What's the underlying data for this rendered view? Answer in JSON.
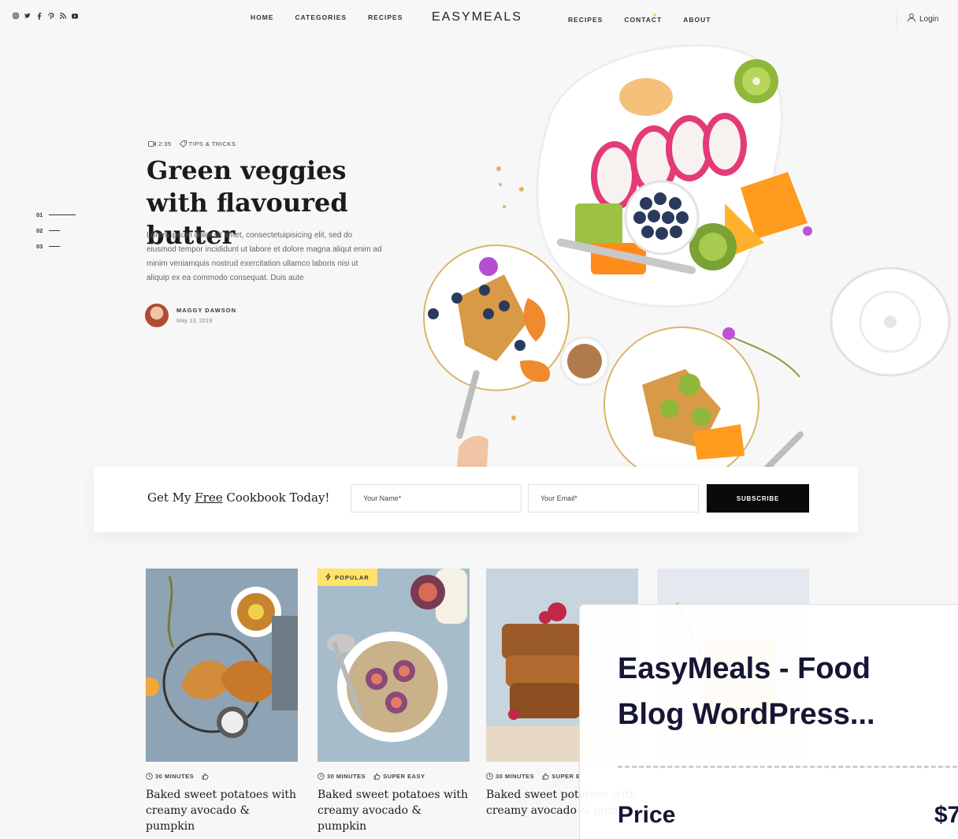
{
  "header": {
    "social_icons": [
      "instagram-icon",
      "twitter-icon",
      "facebook-icon",
      "pinterest-icon",
      "rss-icon",
      "youtube-icon"
    ],
    "nav_left": [
      "HOME",
      "CATEGORIES",
      "RECIPES"
    ],
    "logo": "EASYMEALS",
    "nav_right": [
      "RECIPES",
      "CONTACT",
      "ABOUT"
    ],
    "login": "Login"
  },
  "hero": {
    "duration": "2:35",
    "category": "TIPS & TRICKS",
    "title": "Green veggies with flavoured butter",
    "text": "Lorem ipsum dolor sit amet, consectetuipisicing elit, sed do eiusmod tempor incididunt ut labore et dolore magna aliqut enim ad minim veniamquis nostrud exercitation ullamco laboris nisi ut aliquip ex ea commodo consequat. Duis aute",
    "author_name": "MAGGY DAWSON",
    "author_date": "May 13, 2019",
    "slides": [
      "01",
      "02",
      "03"
    ]
  },
  "subscribe": {
    "text_before": "Get My ",
    "text_free": "Free",
    "text_after": " Cookbook Today!",
    "name_placeholder": "Your Name*",
    "email_placeholder": "Your Email*",
    "button": "SUBSCRIBE"
  },
  "cards": [
    {
      "time": "30 MINUTES",
      "difficulty": "",
      "title": "Baked sweet potatoes with creamy avocado & pumpkin"
    },
    {
      "badge": "POPULAR",
      "time": "30 MINUTES",
      "difficulty": "SUPER EASY",
      "title": "Baked sweet potatoes with creamy avocado & pumpkin"
    },
    {
      "time": "30 MINUTES",
      "difficulty": "SUPER E",
      "title": "Baked sweet potatoes with creamy avocado & pumpk"
    }
  ],
  "overlay": {
    "title": "EasyMeals - Food Blog WordPress...",
    "price_label": "Price",
    "price_value": "$7"
  },
  "colors": {
    "accent_yellow": "#ffe36a",
    "button_black": "#0a0a0a",
    "overlay_text": "#161634"
  }
}
